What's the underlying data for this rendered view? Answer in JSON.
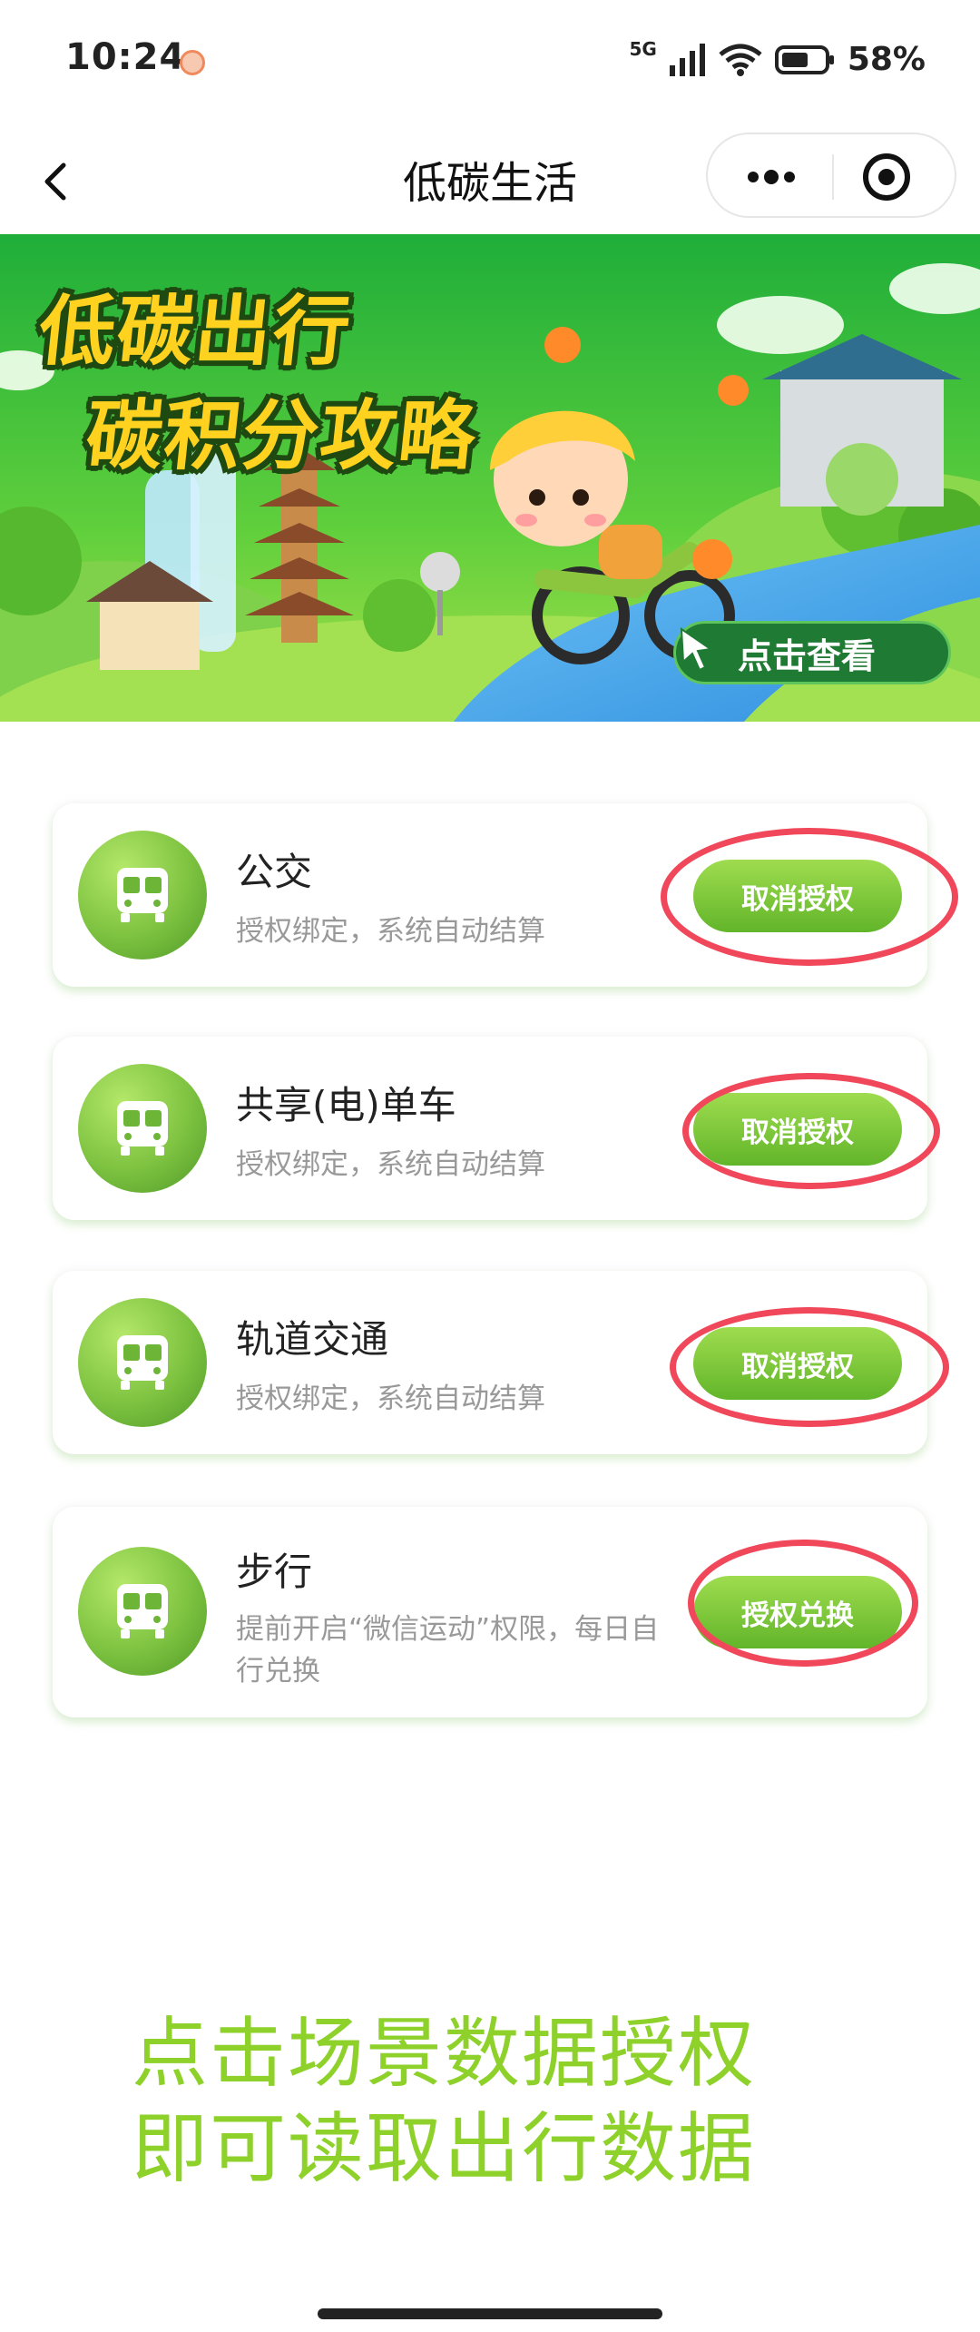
{
  "status_bar": {
    "time": "10:24",
    "network": "5G",
    "battery": "58%"
  },
  "nav": {
    "title": "低碳生活",
    "icons": [
      "back-icon",
      "more-icon",
      "close-icon"
    ]
  },
  "banner": {
    "line1": "低碳出行",
    "line2": "碳积分攻略",
    "cta": "点击查看"
  },
  "cards": [
    {
      "title": "公交",
      "desc": "授权绑定，系统自动结算",
      "button": "取消授权",
      "icon": "bus-icon"
    },
    {
      "title": "共享(电)单车",
      "desc": "授权绑定，系统自动结算",
      "button": "取消授权",
      "icon": "bus-icon"
    },
    {
      "title": "轨道交通",
      "desc": "授权绑定，系统自动结算",
      "button": "取消授权",
      "icon": "bus-icon"
    },
    {
      "title": "步行",
      "desc": "提前开启“微信运动”权限，每日自行兑换",
      "button": "授权兑换",
      "icon": "bus-icon"
    }
  ],
  "hint": {
    "line1": "点击场景数据授权",
    "line2": "即可读取出行数据"
  },
  "colors": {
    "accent_green": "#62b52a",
    "hint_green": "#8ed12a",
    "annotation_red": "#f0485a"
  }
}
